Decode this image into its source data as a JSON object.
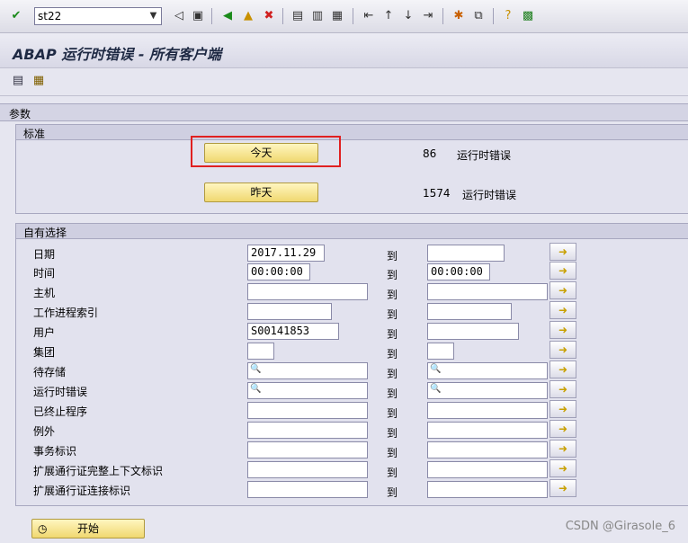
{
  "toolbar": {
    "command_value": "st22",
    "icons": [
      "check-icon",
      "back-icon",
      "save-icon",
      "navigate-back-icon",
      "exit-icon",
      "cancel-icon",
      "print-icon",
      "find-icon",
      "find-next-icon",
      "first-page-icon",
      "prev-page-icon",
      "next-page-icon",
      "last-page-icon",
      "new-session-icon",
      "shortcut-icon",
      "help-icon",
      "layout-icon"
    ]
  },
  "title": "ABAP 运行时错误 - 所有客户端",
  "params_header": "参数",
  "standard": {
    "title": "标准",
    "today_label": "今天",
    "today_count": "86",
    "today_text": "运行时错误",
    "yesterday_label": "昨天",
    "yesterday_count": "1574",
    "yesterday_text": "运行时错误"
  },
  "own": {
    "title": "自有选择",
    "to_label": "到",
    "rows": [
      {
        "label": "日期",
        "from": "2017.11.29",
        "to": ""
      },
      {
        "label": "时间",
        "from": "00:00:00",
        "to": "00:00:00"
      },
      {
        "label": "主机",
        "from": "",
        "to": ""
      },
      {
        "label": "工作进程索引",
        "from": "",
        "to": ""
      },
      {
        "label": "用户",
        "from": "S00141853",
        "to": ""
      },
      {
        "label": "集团",
        "from": "",
        "to": ""
      },
      {
        "label": "待存储",
        "from": "",
        "to": ""
      },
      {
        "label": "运行时错误",
        "from": "",
        "to": ""
      },
      {
        "label": "已终止程序",
        "from": "",
        "to": ""
      },
      {
        "label": "例外",
        "from": "",
        "to": ""
      },
      {
        "label": "事务标识",
        "from": "",
        "to": ""
      },
      {
        "label": "扩展通行证完整上下文标识",
        "from": "",
        "to": ""
      },
      {
        "label": "扩展通行证连接标识",
        "from": "",
        "to": ""
      }
    ]
  },
  "start_label": "开始",
  "watermark": "CSDN @Girasole_6"
}
